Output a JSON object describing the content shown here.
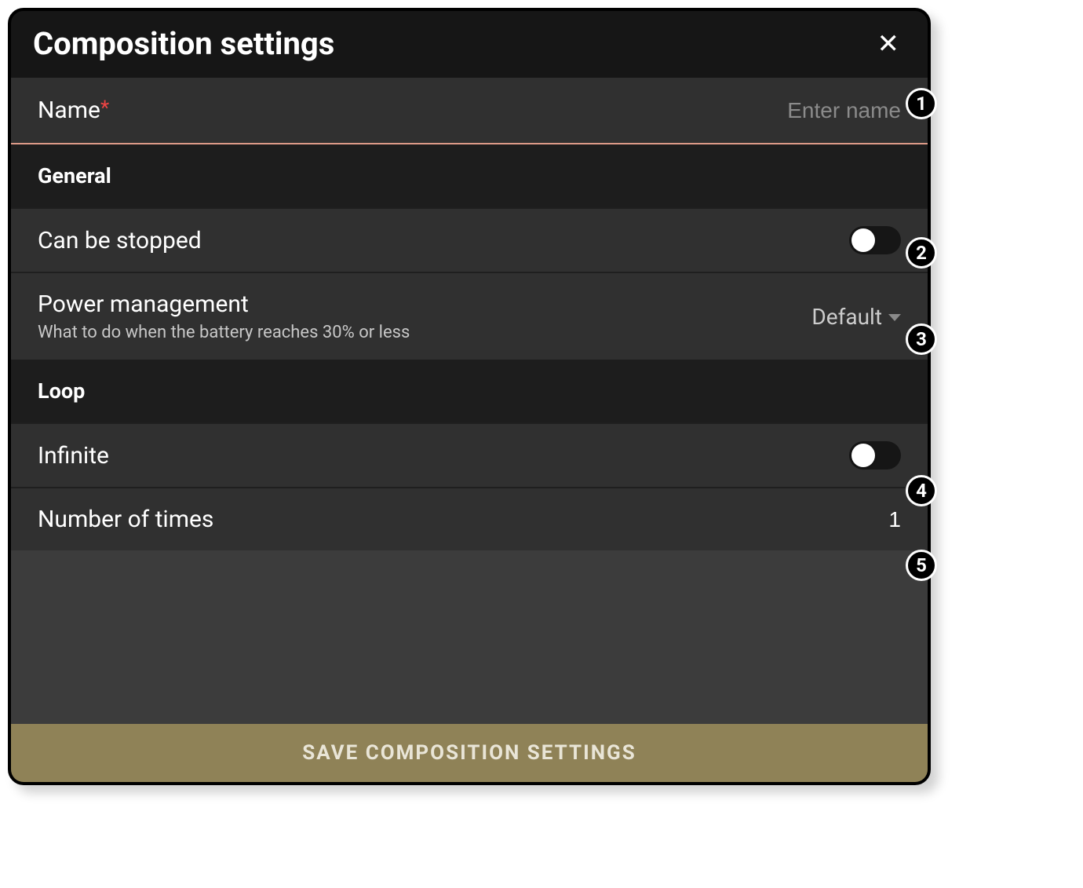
{
  "header": {
    "title": "Composition settings"
  },
  "name_field": {
    "label": "Name",
    "required_mark": "*",
    "placeholder": "Enter name",
    "value": ""
  },
  "sections": {
    "general": {
      "title": "General",
      "can_be_stopped": {
        "label": "Can be stopped",
        "value": false
      },
      "power_management": {
        "label": "Power management",
        "description": "What to do when the battery reaches 30% or less",
        "selected": "Default"
      }
    },
    "loop": {
      "title": "Loop",
      "infinite": {
        "label": "Infinite",
        "value": false
      },
      "times": {
        "label": "Number of times",
        "value": "1"
      }
    }
  },
  "footer": {
    "save_label": "SAVE COMPOSITION SETTINGS"
  },
  "callouts": [
    "1",
    "2",
    "3",
    "4",
    "5"
  ]
}
